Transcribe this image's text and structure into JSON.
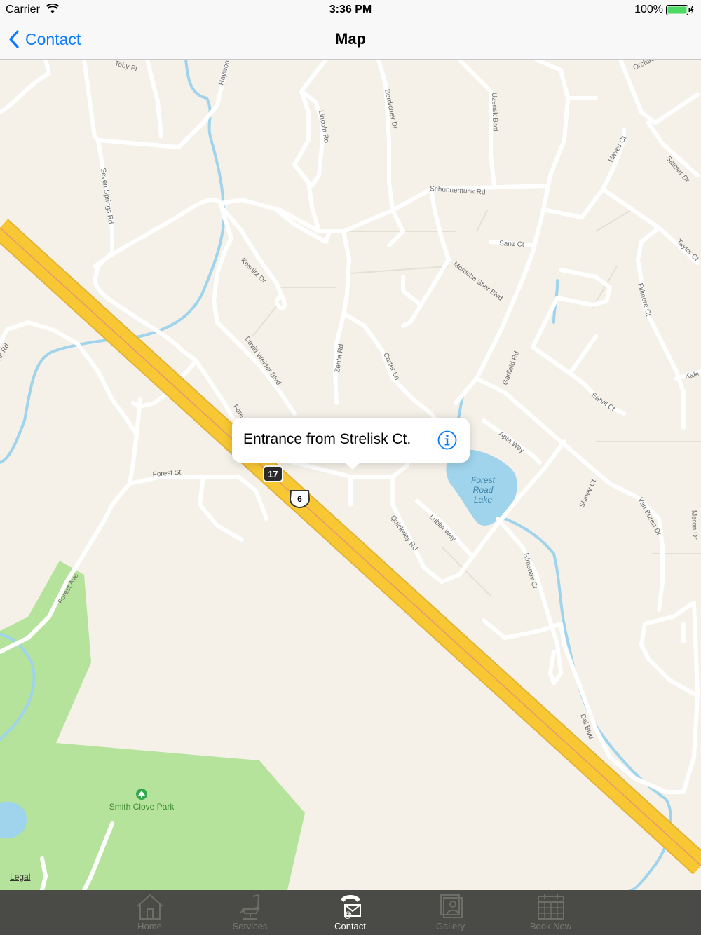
{
  "status_bar": {
    "carrier": "Carrier",
    "time": "3:36 PM",
    "battery": "100%"
  },
  "nav": {
    "back_label": "Contact",
    "title": "Map"
  },
  "map": {
    "callout_text": "Entrance from Strelisk Ct.",
    "legal": "Legal",
    "park_name": "Smith Clove Park",
    "lake_name_1": "Forest",
    "lake_name_2": "Road",
    "lake_name_3": "Lake",
    "route_17": "17",
    "route_6": "6",
    "streets": {
      "toby": "Toby Pl",
      "raywood": "Raywood",
      "lincoln": "Lincoln Rd",
      "berdichev": "Berdichev Dr",
      "uzensk": "Uzensk Blvd",
      "orshava": "Orshava",
      "seven_springs": "Seven Springs Rd",
      "schunnemunk": "Schunnemunk Rd",
      "hayes": "Hayes Ct",
      "satmar": "Satmar Dr",
      "sanz": "Sanz Ct",
      "taylor": "Taylor Ct",
      "kosnitz": "Kosnitz Dr",
      "mordche": "Mordche Sher Blvd",
      "fillmore": "Fillmore Ct",
      "zenta": "Zenta Rd",
      "david_weider": "David Weider Blvd",
      "carter": "Carter Ln",
      "garfield": "Garfield Rd",
      "kale": "Kale",
      "eahal": "Eahal Ct",
      "nk_rd": "nk Rd",
      "forest_left": "Fore",
      "apta": "Apta Way",
      "forest_st": "Forest St",
      "shinev": "Shinev Ct",
      "van_buren": "Van Buren Dr",
      "meron": "Meron Dr",
      "quickway": "Quickway Rd",
      "lublin": "Lublin Way",
      "rimenev": "Rimenev Ct",
      "forest_ave": "Forest Ave",
      "dal": "Dal Blvd"
    }
  },
  "tabs": [
    {
      "label": "Home",
      "icon": "home-icon"
    },
    {
      "label": "Services",
      "icon": "barber-chair-icon"
    },
    {
      "label": "Contact",
      "icon": "phone-mail-icon",
      "active": true
    },
    {
      "label": "Gallery",
      "icon": "photo-stack-icon"
    },
    {
      "label": "Book Now",
      "icon": "calendar-icon"
    }
  ],
  "colors": {
    "accent": "#0a7aff",
    "highway": "#f7c833",
    "park": "#b6e39c",
    "water": "#9fd4ec",
    "land": "#f5f1e9",
    "tabbar": "#4a4a46"
  }
}
